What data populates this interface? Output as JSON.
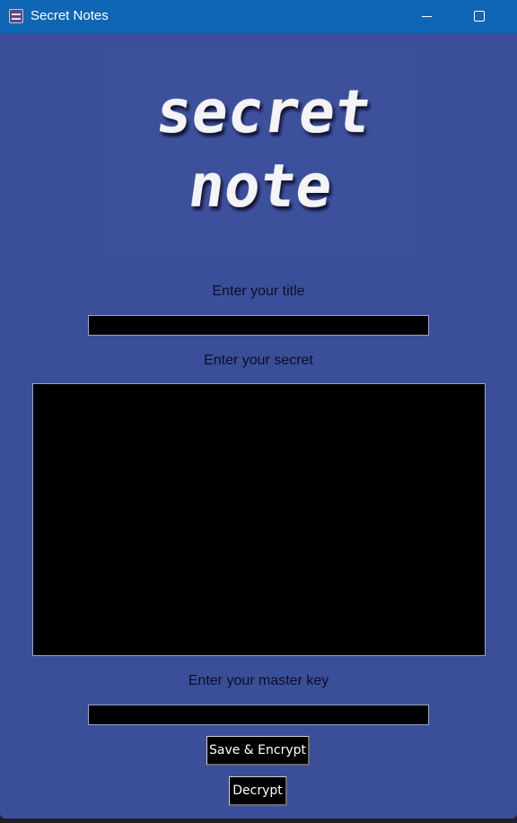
{
  "window": {
    "title": "Secret Notes",
    "app_icon": "app-icon",
    "controls": [
      "minimize-icon",
      "maximize-icon"
    ],
    "titlebar_color": "#0f66b4",
    "background_color": "#3b4e99"
  },
  "logo": {
    "line1": "secret",
    "line2": "note"
  },
  "form": {
    "title_label": "Enter your title",
    "title_value": "",
    "secret_label": "Enter your secret",
    "secret_value": "",
    "key_label": "Enter your master key",
    "key_value": ""
  },
  "buttons": {
    "save_label": "Save & Encrypt",
    "decrypt_label": "Decrypt"
  }
}
